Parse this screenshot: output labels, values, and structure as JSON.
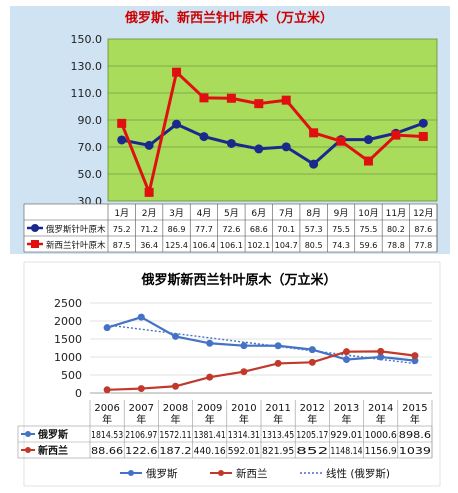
{
  "chart_data": [
    {
      "type": "line",
      "title": "俄罗斯、新西兰针叶原木（万立米）",
      "categories": [
        "1月",
        "2月",
        "3月",
        "4月",
        "5月",
        "6月",
        "7月",
        "8月",
        "9月",
        "10月",
        "11月",
        "12月"
      ],
      "ylim": [
        30.0,
        150.0
      ],
      "yticks": [
        "30.0",
        "50.0",
        "70.0",
        "90.0",
        "110.0",
        "130.0",
        "150.0"
      ],
      "grid": true,
      "colors": {
        "plot_bg": "#a8dc5a",
        "outer_bg": "#cfe3f3"
      },
      "series": [
        {
          "name": "俄罗斯针叶原木",
          "color": "#1a2a8c",
          "marker": "circle",
          "values": [
            75.2,
            71.2,
            86.9,
            77.7,
            72.6,
            68.6,
            70.1,
            57.3,
            75.5,
            75.5,
            80.2,
            87.6
          ],
          "labels": [
            "75.2",
            "71.2",
            "86.9",
            "77.7",
            "72.6",
            "68.6",
            "70.1",
            "57.3",
            "75.5",
            "75.5",
            "80.2",
            "87.6"
          ]
        },
        {
          "name": "新西兰针叶原木",
          "color": "#e01010",
          "marker": "square",
          "values": [
            87.5,
            36.4,
            125.4,
            106.4,
            106.1,
            102.1,
            104.7,
            80.5,
            74.3,
            59.6,
            78.8,
            77.8
          ],
          "labels": [
            "87.5",
            "36.4",
            "125.4",
            "106.4",
            "106.1",
            "102.1",
            "104.7",
            "80.5",
            "74.3",
            "59.6",
            "78.8",
            "77.8"
          ]
        }
      ]
    },
    {
      "type": "line",
      "title": "俄罗斯新西兰针叶原木（万立米）",
      "categories": [
        "2006\n年",
        "2007\n年",
        "2008\n年",
        "2009\n年",
        "2010\n年",
        "2011\n年",
        "2012\n年",
        "2013\n年",
        "2014\n年",
        "2015\n年"
      ],
      "ylim": [
        0,
        2500
      ],
      "yticks": [
        "0",
        "500",
        "1000",
        "1500",
        "2000",
        "2500"
      ],
      "grid": true,
      "legend_position": "bottom",
      "series": [
        {
          "name": "俄罗斯",
          "color": "#4472c4",
          "marker": "circle",
          "values": [
            1814.53,
            2106.97,
            1572.11,
            1381.41,
            1314.31,
            1313.45,
            1205.17,
            929.01,
            1000.6,
            898.6
          ],
          "labels": [
            "1814.53",
            "2106.97",
            "1572.11",
            "1381.41",
            "1314.31",
            "1313.45",
            "1205.17",
            "929.01",
            "1000.6",
            "898.6"
          ]
        },
        {
          "name": "新西兰",
          "color": "#c0392b",
          "marker": "circle",
          "values": [
            88.66,
            122.6,
            187.2,
            440.16,
            592.01,
            821.95,
            852,
            1148.14,
            1156.9,
            1039
          ],
          "labels": [
            "88.66",
            "122.6",
            "187.2",
            "440.16",
            "592.01",
            "821.95",
            "852",
            "1148.14",
            "1156.9",
            "1039"
          ]
        },
        {
          "name": "线性 (俄罗斯)",
          "color": "#4472c4",
          "style": "dotted",
          "trendline_of": "俄罗斯"
        }
      ]
    }
  ]
}
